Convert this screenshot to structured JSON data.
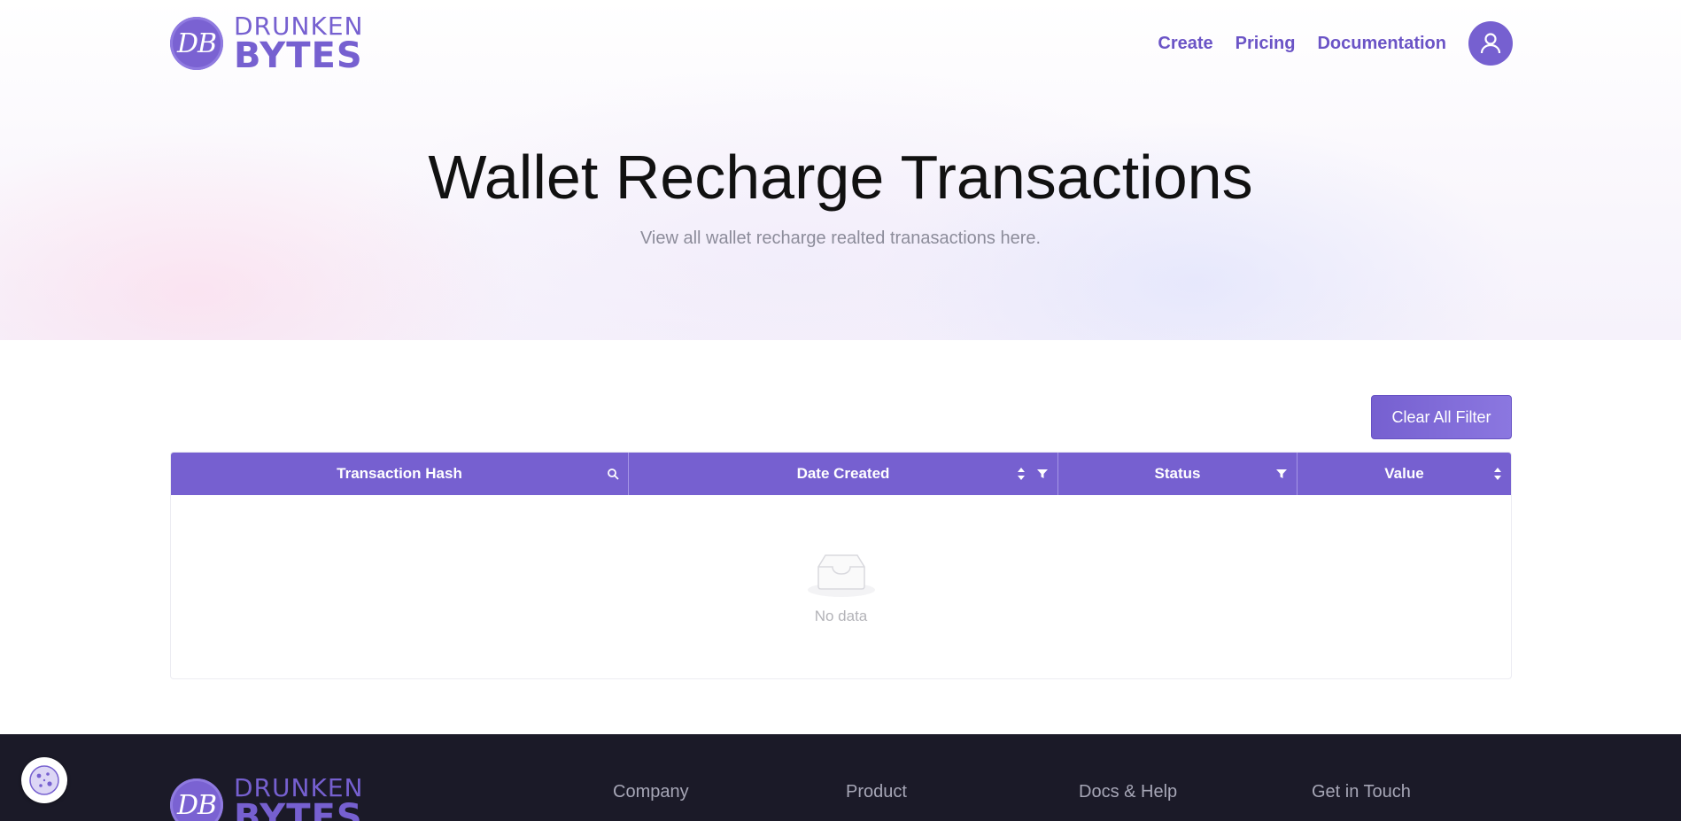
{
  "brand": {
    "badge": "DB",
    "line1": "DRUNKEN",
    "line2": "BYTES"
  },
  "nav": {
    "items": [
      {
        "label": "Create"
      },
      {
        "label": "Pricing"
      },
      {
        "label": "Documentation"
      }
    ]
  },
  "hero": {
    "title": "Wallet Recharge Transactions",
    "subtitle": "View all wallet recharge realted tranasactions here."
  },
  "toolbar": {
    "clear_filter_label": "Clear All Filter"
  },
  "table": {
    "columns": [
      {
        "label": "Transaction Hash",
        "icons": [
          "search-icon"
        ]
      },
      {
        "label": "Date Created",
        "icons": [
          "sort-icon",
          "filter-icon"
        ]
      },
      {
        "label": "Status",
        "icons": [
          "filter-icon"
        ]
      },
      {
        "label": "Value",
        "icons": [
          "sort-icon"
        ]
      }
    ],
    "rows": [],
    "empty_text": "No data"
  },
  "footer": {
    "columns": [
      {
        "label": "Company"
      },
      {
        "label": "Product"
      },
      {
        "label": "Docs & Help"
      },
      {
        "label": "Get in Touch"
      }
    ]
  },
  "colors": {
    "accent": "#7660d0",
    "footer_bg": "#1b1a28"
  }
}
